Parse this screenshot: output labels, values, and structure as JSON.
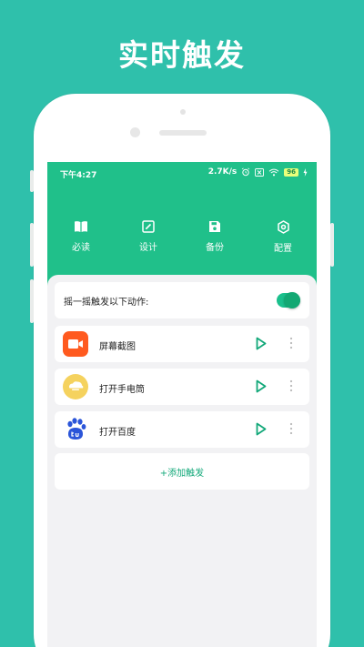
{
  "headline": "实时触发",
  "status_bar": {
    "time": "下午4:27",
    "speed": "2.7K/s",
    "battery": "96"
  },
  "tabs": [
    {
      "label": "必读",
      "icon": "book-icon"
    },
    {
      "label": "设计",
      "icon": "edit-icon"
    },
    {
      "label": "备份",
      "icon": "save-icon"
    },
    {
      "label": "配置",
      "icon": "settings-icon"
    }
  ],
  "shake": {
    "label": "摇一摇触发以下动作:",
    "enabled": true
  },
  "actions": [
    {
      "label": "屏幕截图",
      "icon": "screen-record-icon",
      "color": "#ff5a1f"
    },
    {
      "label": "打开手电筒",
      "icon": "flashlight-icon",
      "color": "#f5d25e"
    },
    {
      "label": "打开百度",
      "icon": "baidu-icon",
      "color": "#2b55d9"
    }
  ],
  "add_label": "+添加触发",
  "colors": {
    "background": "#2fc0ab",
    "header": "#20c08a",
    "accent": "#12a879"
  }
}
